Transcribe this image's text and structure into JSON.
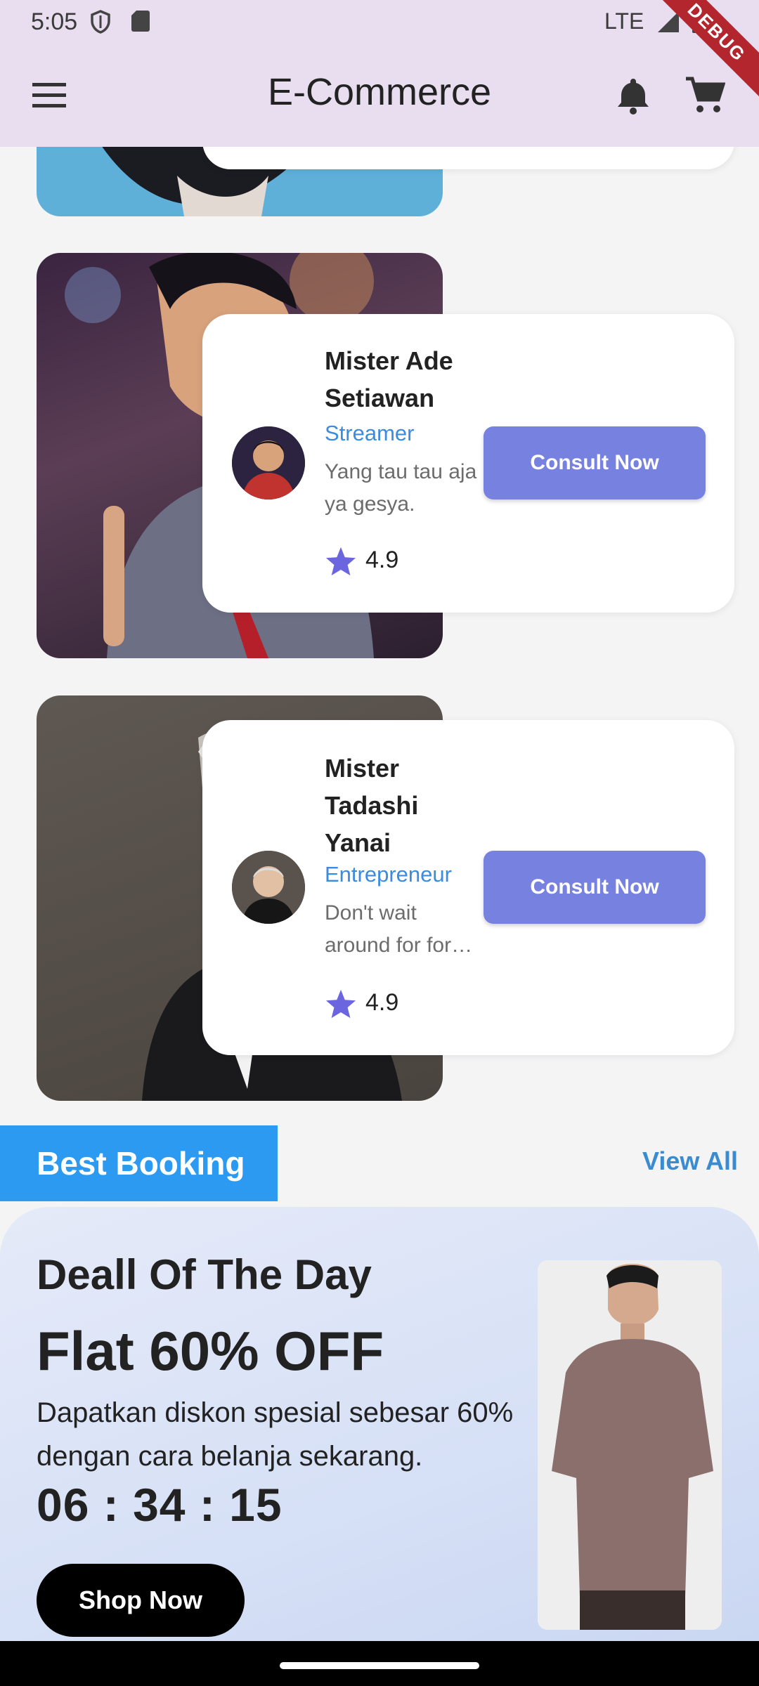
{
  "status_bar": {
    "time": "5:05",
    "network": "LTE"
  },
  "debug_banner": "DEBUG",
  "app_bar": {
    "title": "E-Commerce"
  },
  "experts": [
    {
      "name": "Mister Ade Setiawan",
      "role": "Streamer",
      "description": "Yang tau tau aja ya gesya.",
      "rating": "4.9",
      "button": "Consult Now"
    },
    {
      "name": "Mister Tadashi Yanai",
      "role": "Entrepreneur",
      "description": "Don't wait around for for…",
      "rating": "4.9",
      "button": "Consult Now"
    }
  ],
  "best_booking": {
    "title": "Best Booking",
    "view_all": "View All"
  },
  "deal": {
    "title": "Deall Of The Day",
    "discount": "Flat 60% OFF",
    "description": "Dapatkan diskon spesial sebesar 60% dengan cara belanja sekarang.",
    "timer": "06 : 34 : 15",
    "button": "Shop Now"
  },
  "colors": {
    "app_bar": "#e8deef",
    "accent_button": "#7781e0",
    "role_text": "#3b8be0",
    "section_header": "#2b9af0",
    "star": "#6b66e0"
  }
}
